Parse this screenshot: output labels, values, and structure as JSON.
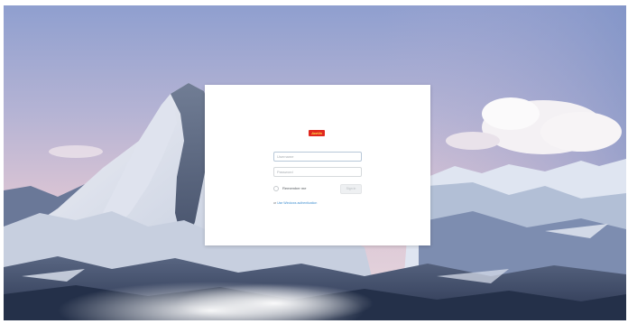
{
  "login": {
    "logo_text": "AceVo",
    "username": {
      "value": "",
      "placeholder": "Username"
    },
    "password": {
      "value": "",
      "placeholder": "Password"
    },
    "remember_label": "Remember me",
    "remember_checked": false,
    "signin_label": "Sign in",
    "alt_prefix": "or",
    "alt_link": "Use Windows authentication"
  },
  "colors": {
    "logo_red": "#e0281f",
    "link_blue": "#3f8fd0",
    "sky_top": "#9aa9d2",
    "card_bg": "#ffffff"
  }
}
